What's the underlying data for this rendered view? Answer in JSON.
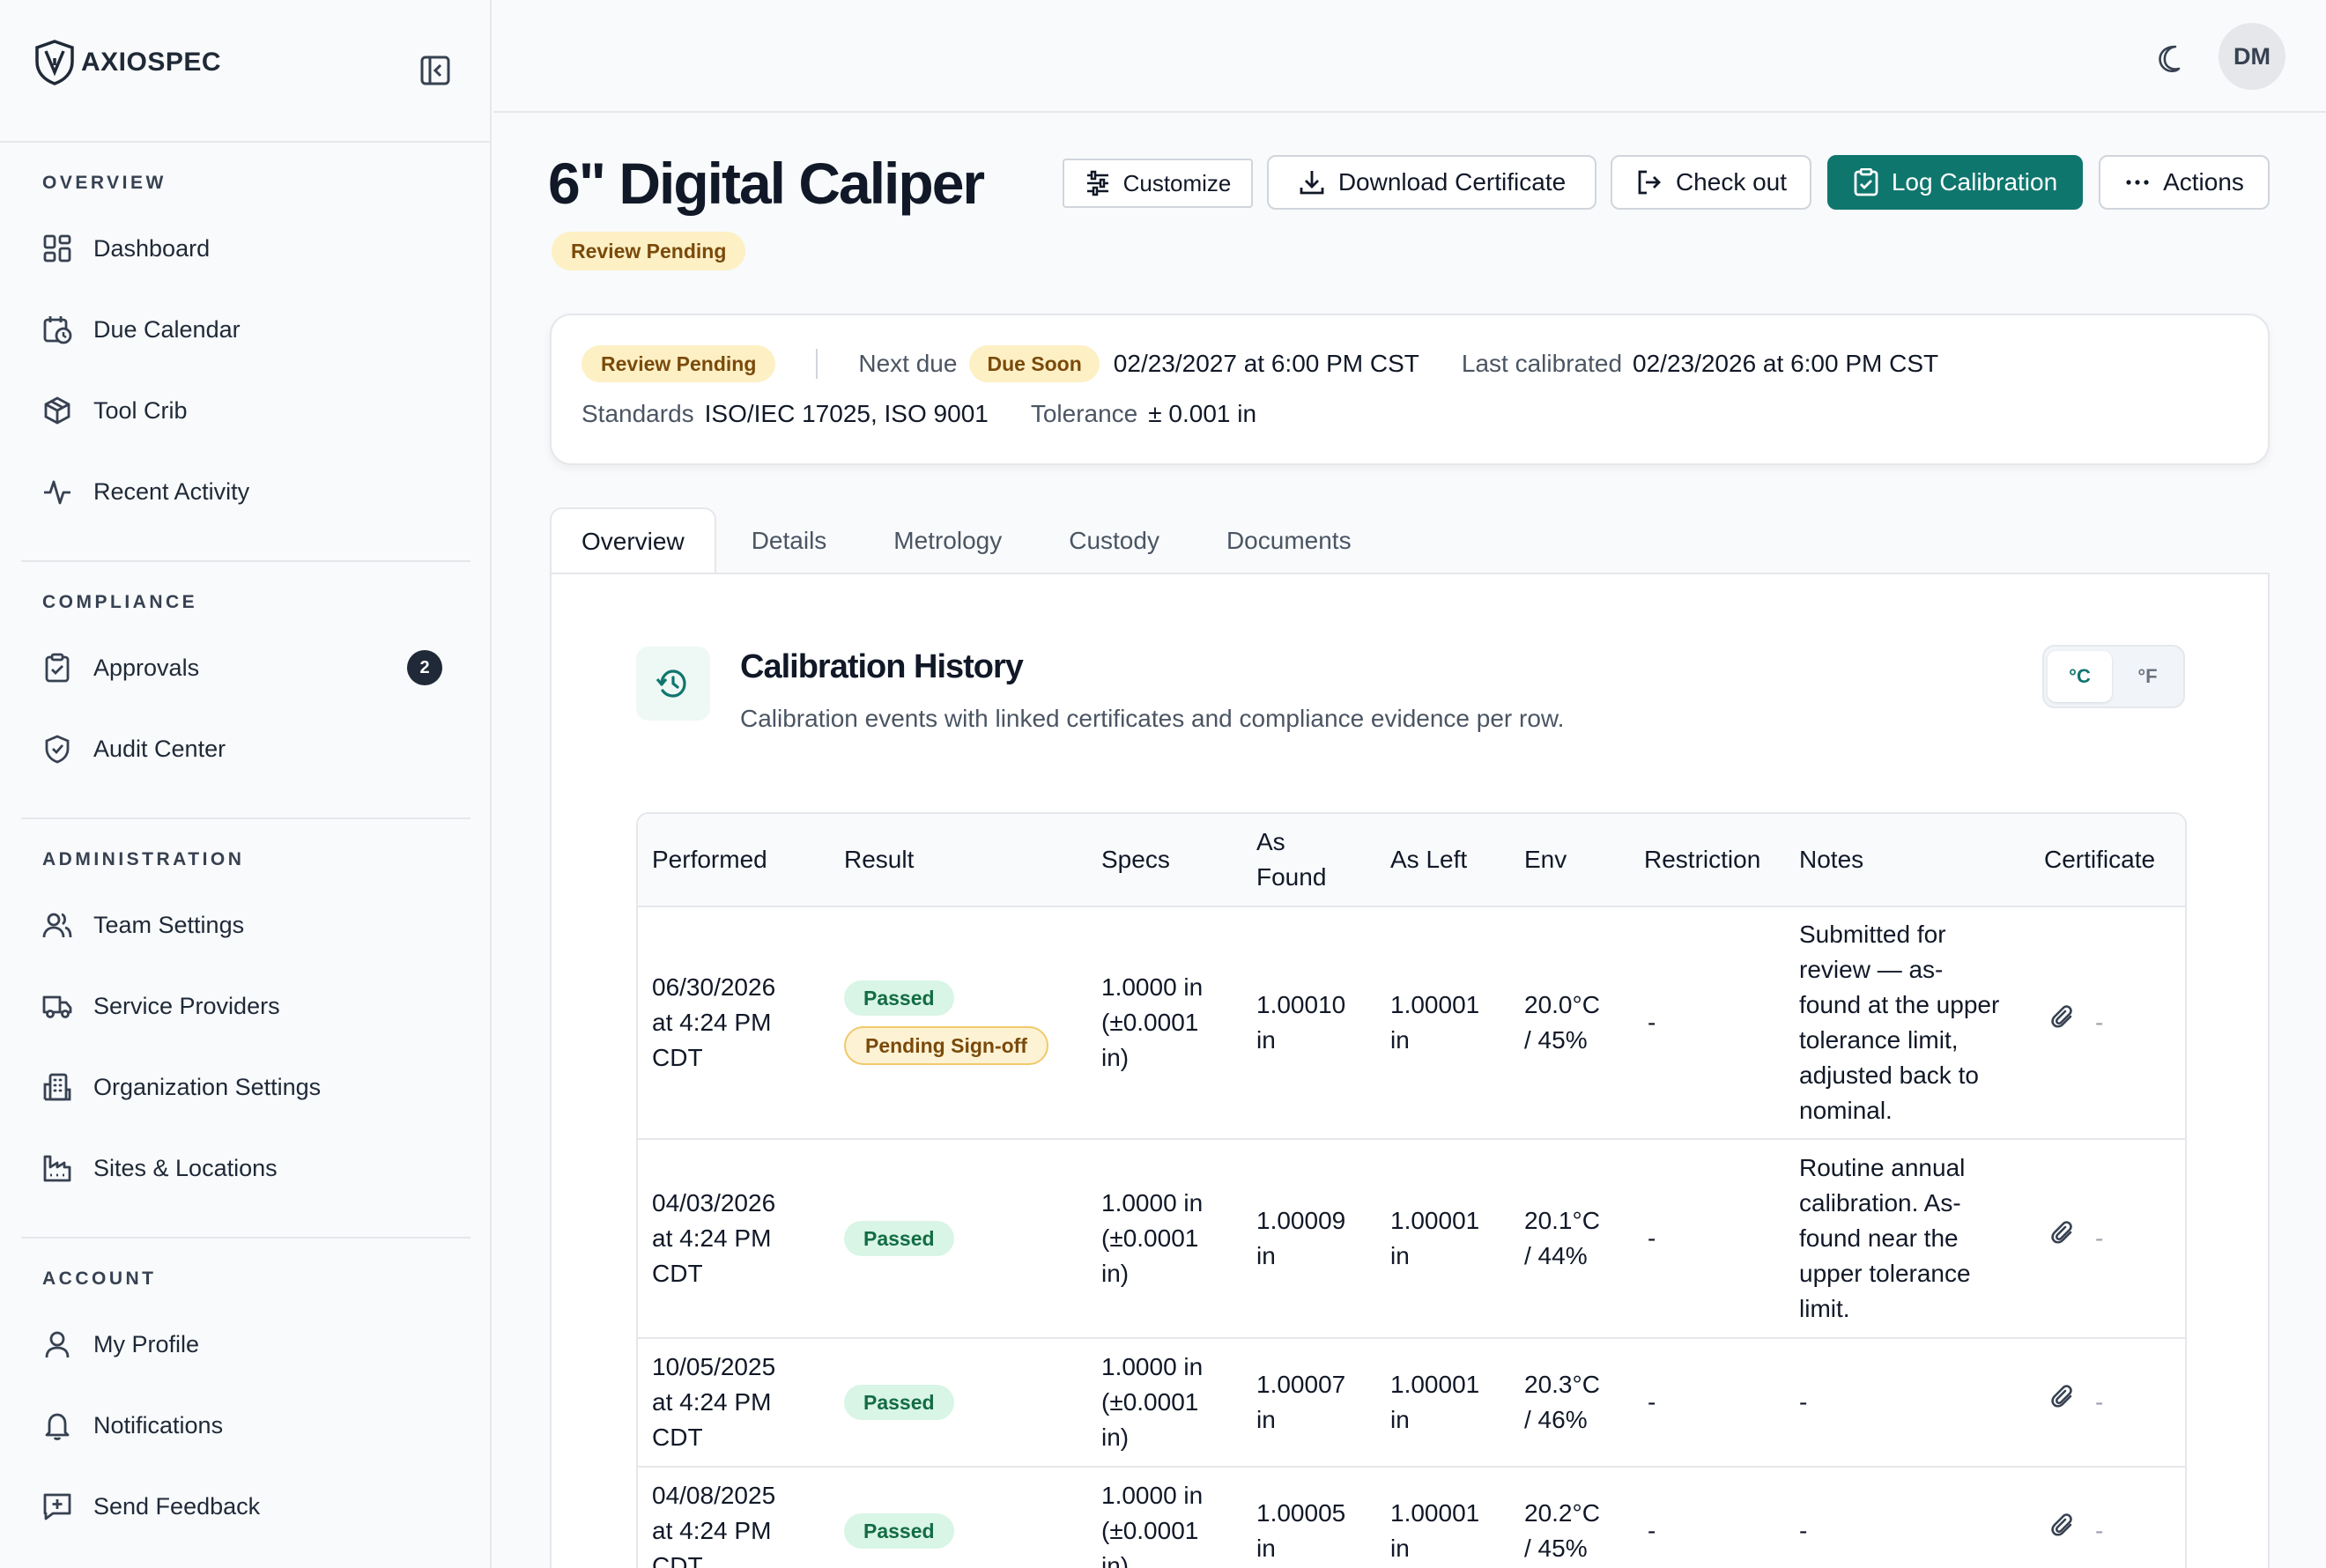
{
  "brand": {
    "name": "AXIOSPEC"
  },
  "sidebar": {
    "sections": [
      {
        "label": "OVERVIEW",
        "items": [
          {
            "label": "Dashboard",
            "icon": "dashboard-icon"
          },
          {
            "label": "Due Calendar",
            "icon": "calendar-clock-icon"
          },
          {
            "label": "Tool Crib",
            "icon": "box-icon"
          },
          {
            "label": "Recent Activity",
            "icon": "activity-icon"
          }
        ]
      },
      {
        "label": "COMPLIANCE",
        "items": [
          {
            "label": "Approvals",
            "icon": "clipboard-check-icon",
            "badge": "2"
          },
          {
            "label": "Audit Center",
            "icon": "shield-check-icon"
          }
        ]
      },
      {
        "label": "ADMINISTRATION",
        "items": [
          {
            "label": "Team Settings",
            "icon": "users-icon"
          },
          {
            "label": "Service Providers",
            "icon": "truck-icon"
          },
          {
            "label": "Organization Settings",
            "icon": "building-icon"
          },
          {
            "label": "Sites & Locations",
            "icon": "factory-icon"
          }
        ]
      },
      {
        "label": "ACCOUNT",
        "items": [
          {
            "label": "My Profile",
            "icon": "user-icon"
          },
          {
            "label": "Notifications",
            "icon": "bell-icon"
          },
          {
            "label": "Send Feedback",
            "icon": "message-plus-icon"
          }
        ]
      }
    ]
  },
  "header": {
    "avatar_initials": "DM"
  },
  "page": {
    "title": "6\" Digital Caliper",
    "status": "Review Pending",
    "actions": {
      "customize": "Customize",
      "download": "Download Certificate",
      "checkout": "Check out",
      "log": "Log Calibration",
      "more": "Actions"
    }
  },
  "summary": {
    "status": "Review Pending",
    "next_due_label": "Next due",
    "next_due_badge": "Due Soon",
    "next_due_value": "02/23/2027 at 6:00 PM CST",
    "last_cal_label": "Last calibrated",
    "last_cal_value": "02/23/2026 at 6:00 PM CST",
    "standards_label": "Standards",
    "standards_value": "ISO/IEC 17025, ISO 9001",
    "tolerance_label": "Tolerance",
    "tolerance_value": "± 0.001 in"
  },
  "tabs": [
    "Overview",
    "Details",
    "Metrology",
    "Custody",
    "Documents"
  ],
  "history": {
    "title": "Calibration History",
    "subtitle": "Calibration events with linked certificates and compliance evidence per row.",
    "units": [
      "°C",
      "°F"
    ],
    "columns": [
      "Performed",
      "Result",
      "Specs",
      "As Found",
      "As Left",
      "Env",
      "Restriction",
      "Notes",
      "Certificate"
    ],
    "rows": [
      {
        "performed": [
          "06/30/2026",
          "at 4:24 PM",
          "CDT"
        ],
        "result": "Passed",
        "result2": "Pending Sign-off",
        "specs": [
          "1.0000 in",
          "(±0.0001",
          "in)"
        ],
        "as_found": [
          "1.00010",
          "in"
        ],
        "as_left": [
          "1.00001",
          "in"
        ],
        "env": [
          "20.0°C",
          "/ 45%"
        ],
        "restriction": "-",
        "notes": [
          "Submitted for",
          "review — as-",
          "found at the upper",
          "tolerance limit,",
          "adjusted back to",
          "nominal."
        ],
        "cert": "-"
      },
      {
        "performed": [
          "04/03/2026",
          "at 4:24 PM",
          "CDT"
        ],
        "result": "Passed",
        "specs": [
          "1.0000 in",
          "(±0.0001",
          "in)"
        ],
        "as_found": [
          "1.00009",
          "in"
        ],
        "as_left": [
          "1.00001",
          "in"
        ],
        "env": [
          "20.1°C",
          "/ 44%"
        ],
        "restriction": "-",
        "notes": [
          "Routine annual",
          "calibration. As-",
          "found near the",
          "upper tolerance",
          "limit."
        ],
        "cert": "-"
      },
      {
        "performed": [
          "10/05/2025",
          "at 4:24 PM",
          "CDT"
        ],
        "result": "Passed",
        "specs": [
          "1.0000 in",
          "(±0.0001",
          "in)"
        ],
        "as_found": [
          "1.00007",
          "in"
        ],
        "as_left": [
          "1.00001",
          "in"
        ],
        "env": [
          "20.3°C",
          "/ 46%"
        ],
        "restriction": "-",
        "notes": [
          "-"
        ],
        "cert": "-"
      },
      {
        "performed": [
          "04/08/2025",
          "at 4:24 PM",
          "CDT"
        ],
        "result": "Passed",
        "specs": [
          "1.0000 in",
          "(±0.0001",
          "in)"
        ],
        "as_found": [
          "1.00005",
          "in"
        ],
        "as_left": [
          "1.00001",
          "in"
        ],
        "env": [
          "20.2°C",
          "/ 45%"
        ],
        "restriction": "-",
        "notes": [
          "-"
        ],
        "cert": "-"
      }
    ]
  }
}
